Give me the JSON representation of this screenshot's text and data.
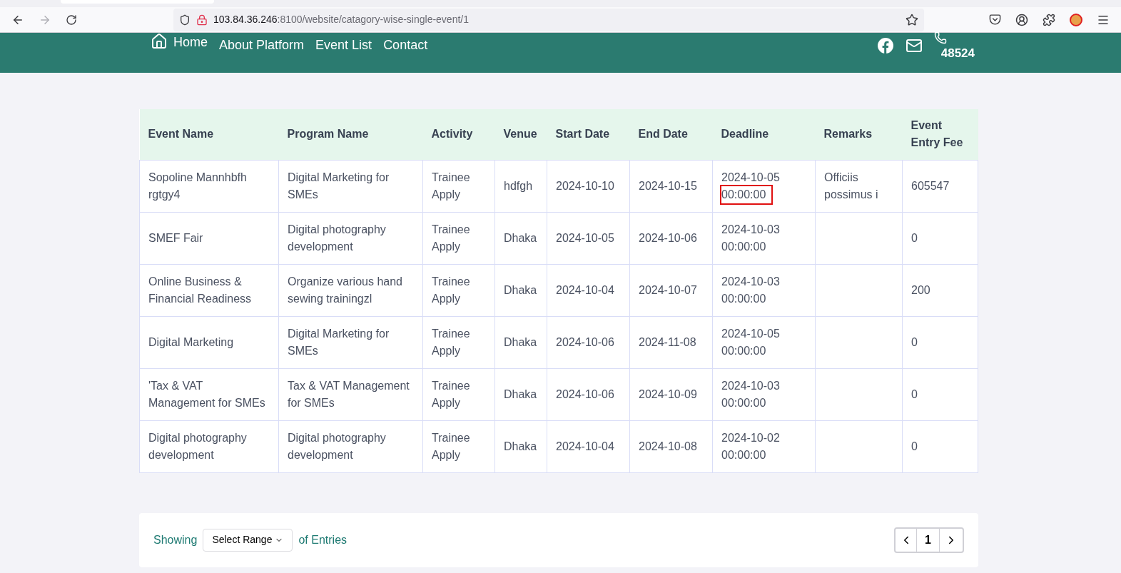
{
  "browser": {
    "url_host": "103.84.36.246",
    "url_path": ":8100/website/catagory-wise-single-event/1"
  },
  "nav": {
    "items": [
      {
        "label": "Home",
        "kind": "home"
      },
      {
        "label": "About Platform",
        "kind": "link"
      },
      {
        "label": "Event List",
        "kind": "link"
      },
      {
        "label": "Contact",
        "kind": "link"
      }
    ],
    "phone": "48524"
  },
  "table": {
    "columns": [
      "Event Name",
      "Program Name",
      "Activity",
      "Venue",
      "Start Date",
      "End Date",
      "Deadline",
      "Remarks",
      "Event Entry Fee"
    ],
    "rows": [
      {
        "event": "Sopoline Mannhbfh rgtgy4",
        "program": "Digital Marketing for SMEs",
        "activity": "Trainee Apply",
        "venue": "hdfgh",
        "start": "2024-10-10",
        "end": "2024-10-15",
        "deadline_date": "2024-10-05",
        "deadline_time": "00:00:00",
        "time_marked": true,
        "remarks": "Officiis possimus i",
        "fee": "605547"
      },
      {
        "event": "SMEF Fair",
        "program": "Digital photography development",
        "activity": "Trainee Apply",
        "venue": "Dhaka",
        "start": "2024-10-05",
        "end": "2024-10-06",
        "deadline_date": "2024-10-03",
        "deadline_time": "00:00:00",
        "time_marked": false,
        "fee": "0"
      },
      {
        "event": "Online Business & Financial Readiness",
        "program": "Organize various hand sewing trainingzl",
        "activity": "Trainee Apply",
        "venue": "Dhaka",
        "start": "2024-10-04",
        "end": "2024-10-07",
        "deadline_date": "2024-10-03",
        "deadline_time": "00:00:00",
        "time_marked": false,
        "fee": "200"
      },
      {
        "event": "Digital Marketing",
        "program": "Digital Marketing for SMEs",
        "activity": "Trainee Apply",
        "venue": "Dhaka",
        "start": "2024-10-06",
        "end": "2024-11-08",
        "deadline_date": "2024-10-05",
        "deadline_time": "00:00:00",
        "time_marked": false,
        "fee": "0"
      },
      {
        "event": "'Tax & VAT Management for SMEs",
        "program": "Tax & VAT Management for SMEs",
        "activity": "Trainee Apply",
        "venue": "Dhaka",
        "start": "2024-10-06",
        "end": "2024-10-09",
        "deadline_date": "2024-10-03",
        "deadline_time": "00:00:00",
        "time_marked": false,
        "fee": "0"
      },
      {
        "event": "Digital photography development",
        "program": "Digital photography development",
        "activity": "Trainee Apply",
        "venue": "Dhaka",
        "start": "2024-10-04",
        "end": "2024-10-08",
        "deadline_date": "2024-10-02",
        "deadline_time": "00:00:00",
        "time_marked": false,
        "fee": "0"
      }
    ]
  },
  "footer": {
    "showing": "Showing",
    "select": "Select Range",
    "entries": "of Entries",
    "pages": [
      {
        "label": "1",
        "selected": true
      }
    ]
  }
}
